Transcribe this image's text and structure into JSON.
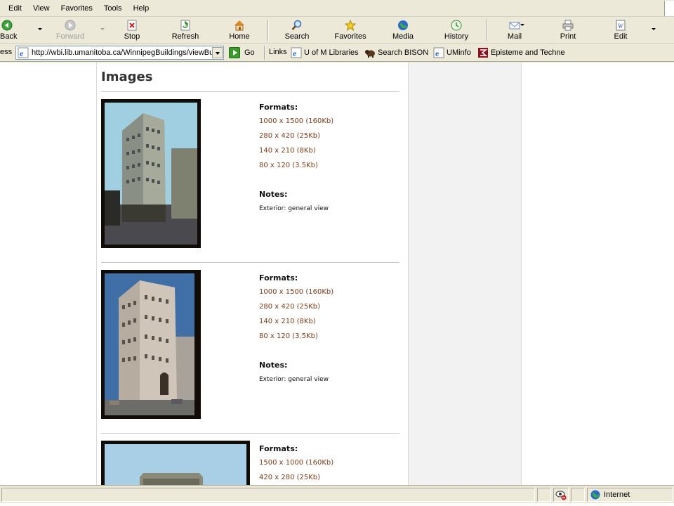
{
  "menu": [
    "Edit",
    "View",
    "Favorites",
    "Tools",
    "Help"
  ],
  "toolbar": {
    "back": "Back",
    "forward": "Forward",
    "stop": "Stop",
    "refresh": "Refresh",
    "home": "Home",
    "search": "Search",
    "favorites": "Favorites",
    "media": "Media",
    "history": "History",
    "mail": "Mail",
    "print": "Print",
    "edit": "Edit"
  },
  "address": {
    "label": "ess",
    "url": "http://wbi.lib.umanitoba.ca/WinnipegBuildings/viewBui",
    "go": "Go"
  },
  "links": {
    "label": "Links",
    "items": [
      "U of M Libraries",
      "Search BISON",
      "UMinfo",
      "Episteme and Techne"
    ]
  },
  "page": {
    "heading": "Images",
    "entries": [
      {
        "formats_title": "Formats:",
        "formats": [
          "1000 x 1500 (160Kb)",
          "280 x 420 (25Kb)",
          "140 x 210 (8Kb)",
          "80 x 120 (3.5Kb)"
        ],
        "notes_title": "Notes:",
        "note": "Exterior: general view"
      },
      {
        "formats_title": "Formats:",
        "formats": [
          "1000 x 1500 (160Kb)",
          "280 x 420 (25Kb)",
          "140 x 210 (8Kb)",
          "80 x 120 (3.5Kb)"
        ],
        "notes_title": "Notes:",
        "note": "Exterior: general view"
      },
      {
        "formats_title": "Formats:",
        "formats": [
          "1500 x 1000 (160Kb)",
          "420 x 280 (25Kb)"
        ]
      }
    ]
  },
  "status": {
    "zone": "Internet"
  },
  "colors": {
    "link": "#7a3e1c",
    "chrome": "#ece9d8",
    "sidebar": "#f2f2f2"
  }
}
